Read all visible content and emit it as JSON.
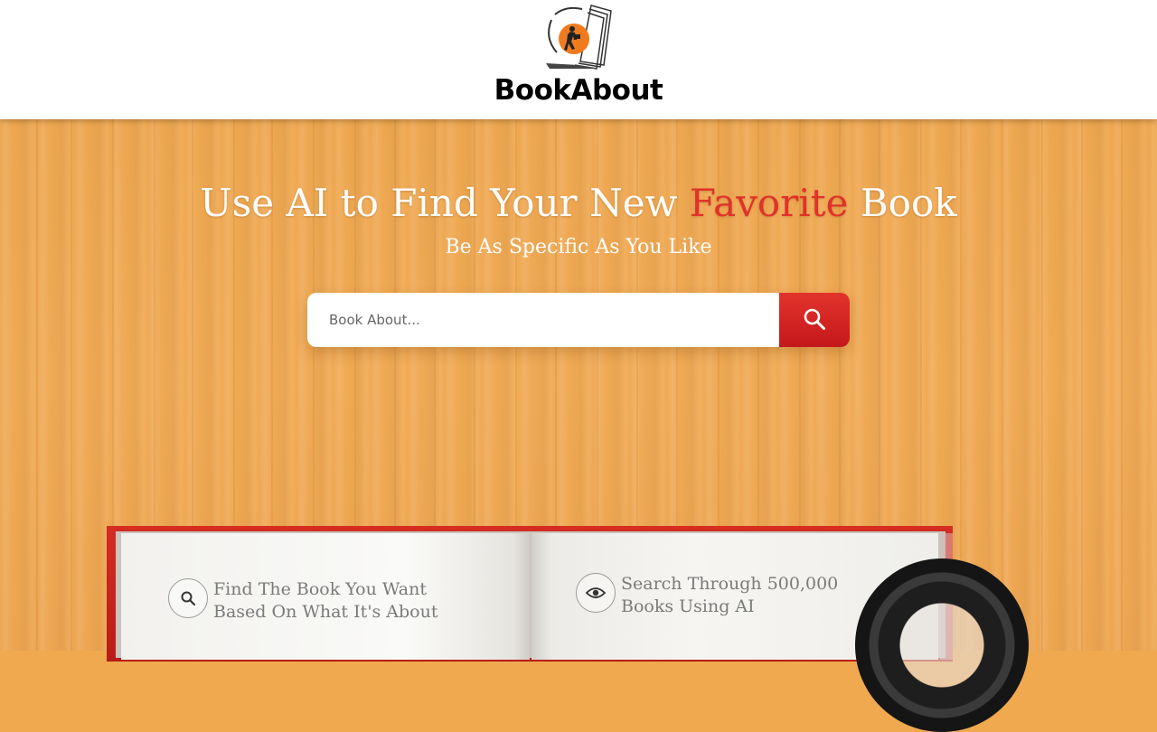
{
  "header": {
    "brand": "BookAbout",
    "logo_icon": "book-reader-logo-icon",
    "logo_colors": {
      "circle": "#f07b1f",
      "figure": "#222222",
      "pages": "#333333"
    }
  },
  "hero": {
    "title_before": "Use AI to Find Your New ",
    "title_accent": "Favorite",
    "title_after": " Book",
    "subtitle": "Be As Specific As You Like",
    "accent_color": "#e0322a"
  },
  "search": {
    "placeholder": "Book About...",
    "value": "",
    "button_icon": "search-icon",
    "button_color": "#d42a24"
  },
  "features": [
    {
      "icon": "search-icon",
      "line1": "Find The Book You Want",
      "line2": "Based On What It's About"
    },
    {
      "icon": "eye-icon",
      "line1": "Search Through 500,000",
      "line2": "Books Using AI"
    }
  ],
  "decor": {
    "background": "wood-planks",
    "background_color": "#f0a94f",
    "book_cover_color": "#c62620",
    "magnifier_icon": "magnifying-glass-icon"
  }
}
